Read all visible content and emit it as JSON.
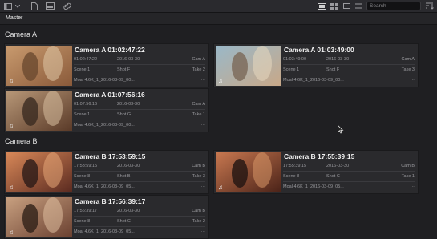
{
  "toolbar": {
    "search_placeholder": "Search"
  },
  "bin": {
    "tab": "Master"
  },
  "sections": [
    {
      "title": "Camera A"
    },
    {
      "title": "Camera B"
    }
  ],
  "clips": [
    {
      "title": "Camera A  01:02:47:22",
      "timecode": "01:02:47:22",
      "date": "2016-03-30",
      "camera": "Cam A",
      "scene": "Scene 1",
      "shot": "Shot F",
      "take": "Take 2",
      "file": "Moal 4.6K_1_2016-03-09_00...",
      "more": "···",
      "palette": [
        "#c89a6e",
        "#8a5a3a",
        "#e0c8a8",
        "#6b4a30"
      ]
    },
    {
      "title": "Camera A  01:03:49:00",
      "timecode": "01:03:49:00",
      "date": "2016-03-30",
      "camera": "Cam A",
      "scene": "Scene 1",
      "shot": "Shot F",
      "take": "Take 3",
      "file": "Moal 4.6K_1_2016-03-09_00...",
      "more": "···",
      "palette": [
        "#9ab8c8",
        "#c8a888",
        "#e8d8c0",
        "#7a6858"
      ]
    },
    {
      "title": "Camera A  01:07:56:16",
      "timecode": "01:07:56:16",
      "date": "2016-03-30",
      "camera": "Cam A",
      "scene": "Scene 1",
      "shot": "Shot G",
      "take": "Take 1",
      "file": "Moal 4.6K_1_2016-03-09_00...",
      "more": "···",
      "palette": [
        "#b89878",
        "#5a3a28",
        "#d8c0a0",
        "#3a2a20"
      ]
    },
    {
      "title": "Camera B  17:53:59:15",
      "timecode": "17:53:59:15",
      "date": "2016-03-30",
      "camera": "Cam B",
      "scene": "Scene 8",
      "shot": "Shot B",
      "take": "Take 3",
      "file": "Moal 4.6K_1_2016-03-09_05...",
      "more": "···",
      "palette": [
        "#d88858",
        "#5a2a20",
        "#e8a878",
        "#2a1a18"
      ]
    },
    {
      "title": "Camera B  17:55:39:15",
      "timecode": "17:55:39:15",
      "date": "2016-03-30",
      "camera": "Cam B",
      "scene": "Scene 8",
      "shot": "Shot C",
      "take": "Take 1",
      "file": "Moal 4.6K_1_2016-03-09_05...",
      "more": "···",
      "palette": [
        "#c87850",
        "#4a2218",
        "#d89868",
        "#201412"
      ]
    },
    {
      "title": "Camera B  17:56:39:17",
      "timecode": "17:56:39:17",
      "date": "2016-03-30",
      "camera": "Cam B",
      "scene": "Scene 8",
      "shot": "Shot C",
      "take": "Take 2",
      "file": "Moal 4.6K_1_2016-03-09_05...",
      "more": "···",
      "palette": [
        "#c8a080",
        "#6a4030",
        "#e0c0a0",
        "#302018"
      ]
    }
  ]
}
